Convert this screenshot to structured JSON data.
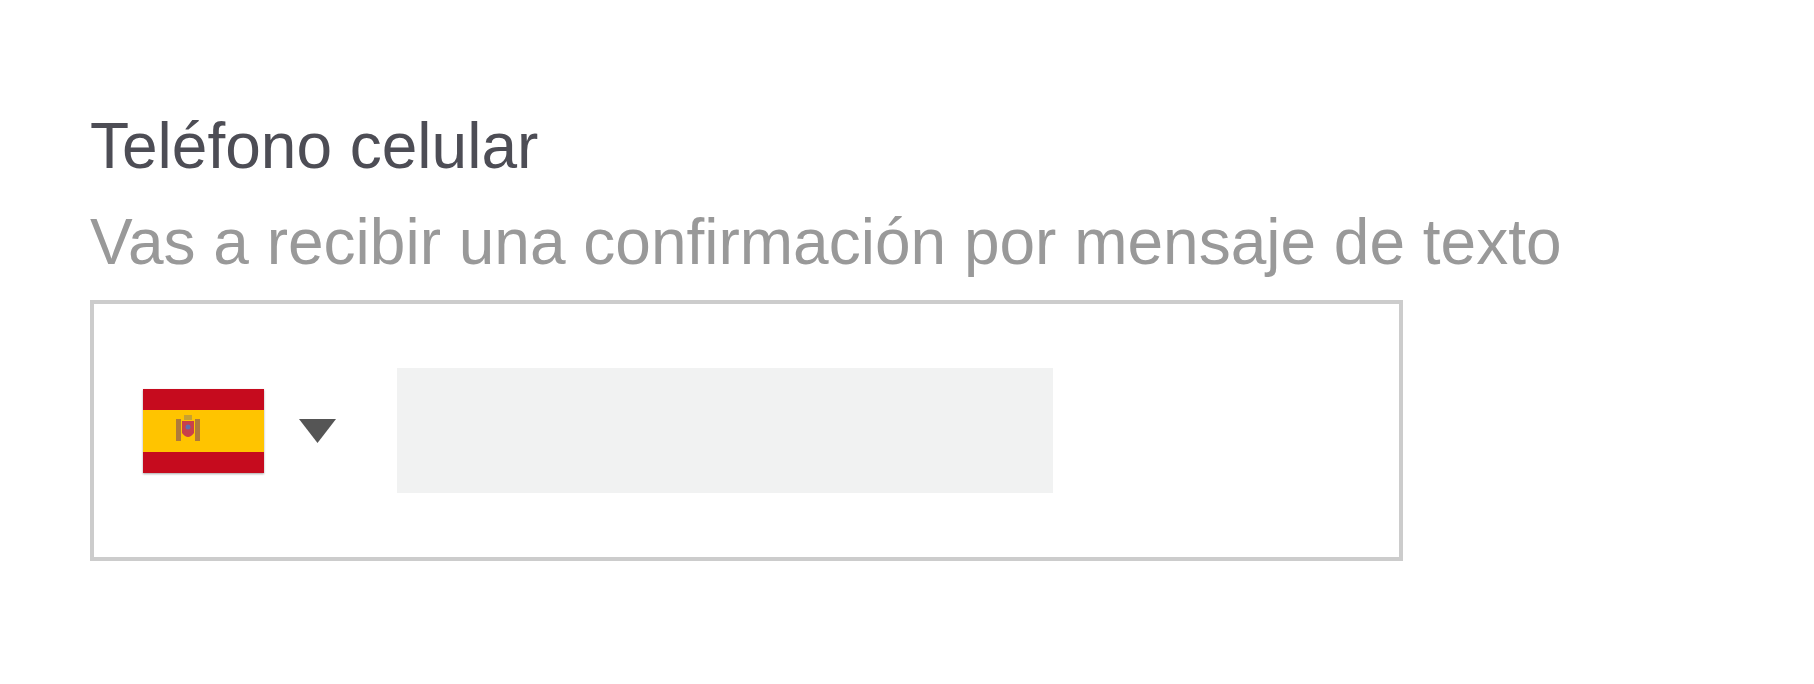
{
  "phone_field": {
    "label": "Teléfono celular",
    "hint": "Vas a recibir una confirmación por mensaje de texto"
  }
}
